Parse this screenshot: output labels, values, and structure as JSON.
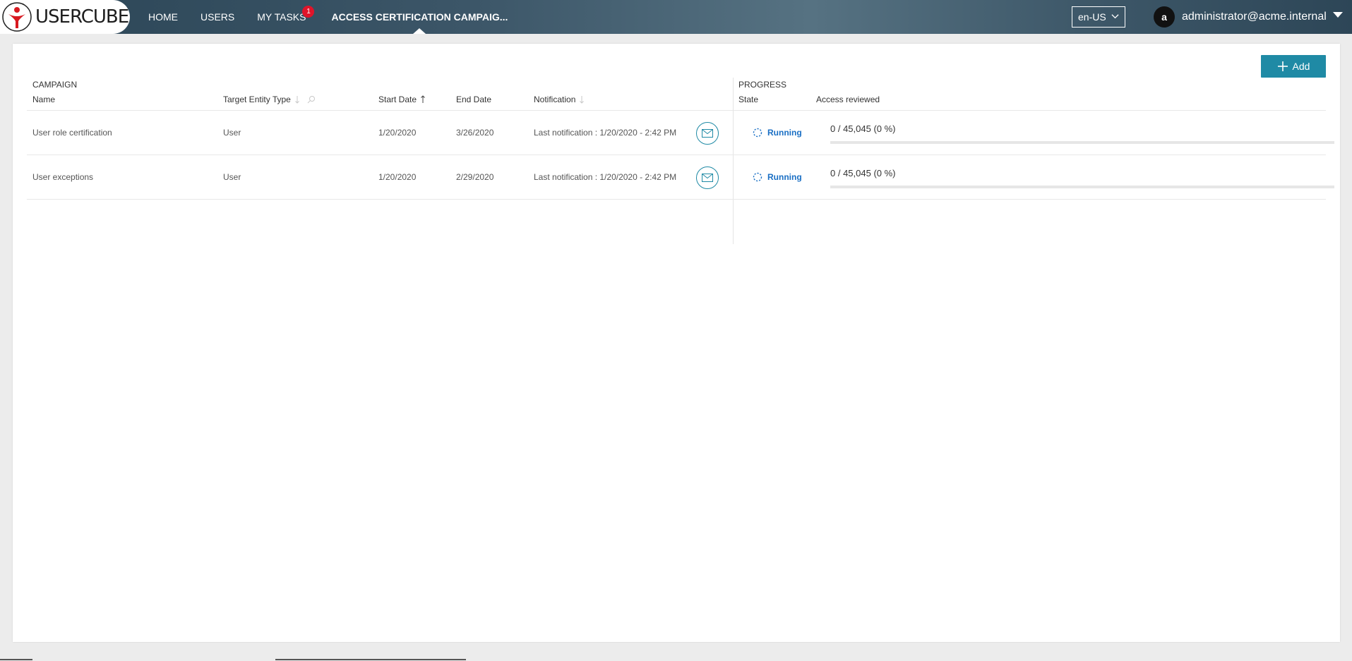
{
  "app": {
    "logo_text": "USERCUBE",
    "nav": [
      {
        "label": "HOME"
      },
      {
        "label": "USERS"
      },
      {
        "label": "MY TASKS",
        "badge": "1"
      },
      {
        "label": "ACCESS CERTIFICATION CAMPAIG..."
      }
    ],
    "active_nav": "ACCESS CERTIFICATION CAMPAIG...",
    "language": "en-US",
    "user": {
      "initial": "a",
      "name": "administrator@acme.internal"
    }
  },
  "toolbar": {
    "add_label": "Add"
  },
  "table": {
    "groups": {
      "campaign": "CAMPAIGN",
      "progress": "PROGRESS"
    },
    "columns": {
      "name": "Name",
      "target_entity_type": "Target Entity Type",
      "start_date": "Start Date",
      "end_date": "End Date",
      "notification": "Notification",
      "state": "State",
      "access_reviewed": "Access reviewed"
    },
    "sorted_column": "start_date",
    "sort_direction": "ascending",
    "rows": [
      {
        "name": "User role certification",
        "target_entity_type": "User",
        "start_date": "1/20/2020",
        "end_date": "3/26/2020",
        "notification": "Last notification : 1/20/2020 - 2:42 PM",
        "state": "Running",
        "access_reviewed": "0 / 45,045 (0 %)",
        "progress_fraction": 0
      },
      {
        "name": "User exceptions",
        "target_entity_type": "User",
        "start_date": "1/20/2020",
        "end_date": "2/29/2020",
        "notification": "Last notification : 1/20/2020 - 2:42 PM",
        "state": "Running",
        "access_reviewed": "0 / 45,045 (0 %)",
        "progress_fraction": 0
      }
    ]
  },
  "colors": {
    "accent": "#1f8aa5",
    "state_running": "#1a6fc4",
    "badge": "#e0142a",
    "header_bar": "#3c5668"
  },
  "icons": {
    "logo": "usercube-logo-icon",
    "language_chevron": "chevron-down-icon",
    "user_menu": "caret-down-icon",
    "add": "plus-icon",
    "sort": "sort-arrow-icon",
    "search": "search-icon",
    "notify": "mail-icon",
    "state": "spinner-icon"
  }
}
